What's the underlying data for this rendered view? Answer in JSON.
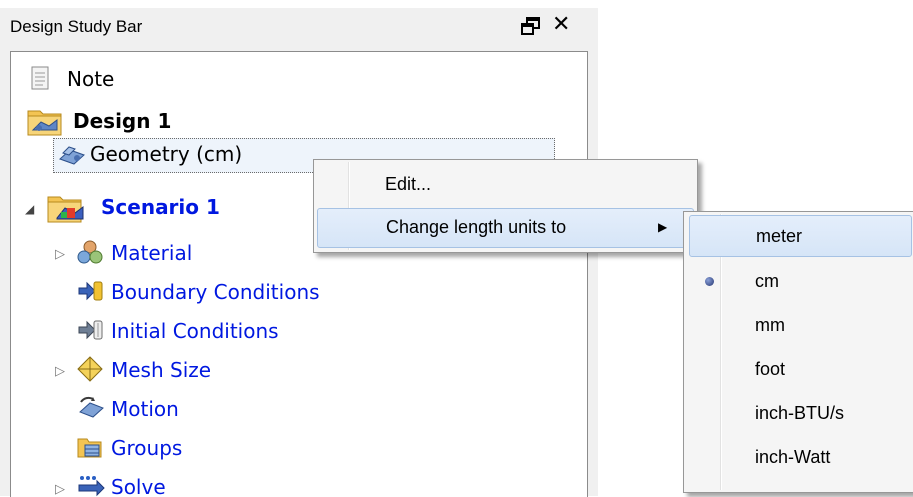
{
  "panel": {
    "title": "Design Study Bar",
    "float_glyph": "float-window-icon",
    "close_label": "✕"
  },
  "tree": {
    "note": "Note",
    "design": "Design 1",
    "geometry": "Geometry (cm)",
    "scenario": "Scenario 1",
    "children": [
      {
        "label": "Material",
        "icon": "material-icon",
        "expander": true
      },
      {
        "label": "Boundary Conditions",
        "icon": "boundary-conditions-icon",
        "expander": false
      },
      {
        "label": "Initial Conditions",
        "icon": "initial-conditions-icon",
        "expander": false
      },
      {
        "label": "Mesh Size",
        "icon": "mesh-size-icon",
        "expander": true
      },
      {
        "label": "Motion",
        "icon": "motion-icon",
        "expander": false
      },
      {
        "label": "Groups",
        "icon": "groups-icon",
        "expander": false
      },
      {
        "label": "Solve",
        "icon": "solve-icon",
        "expander": true
      }
    ]
  },
  "context_menu": {
    "items": [
      {
        "label": "Edit..."
      },
      {
        "label": "Change length units to",
        "submenu_arrow": "▶"
      }
    ]
  },
  "units_menu": {
    "items": [
      {
        "label": "meter",
        "selected": false,
        "highlighted": true
      },
      {
        "label": "cm",
        "selected": true
      },
      {
        "label": "mm",
        "selected": false
      },
      {
        "label": "foot",
        "selected": false
      },
      {
        "label": "inch-BTU/s",
        "selected": false
      },
      {
        "label": "inch-Watt",
        "selected": false
      }
    ]
  },
  "colors": {
    "scenario_text": "#0018e0",
    "highlight": "#d6e5f7"
  }
}
